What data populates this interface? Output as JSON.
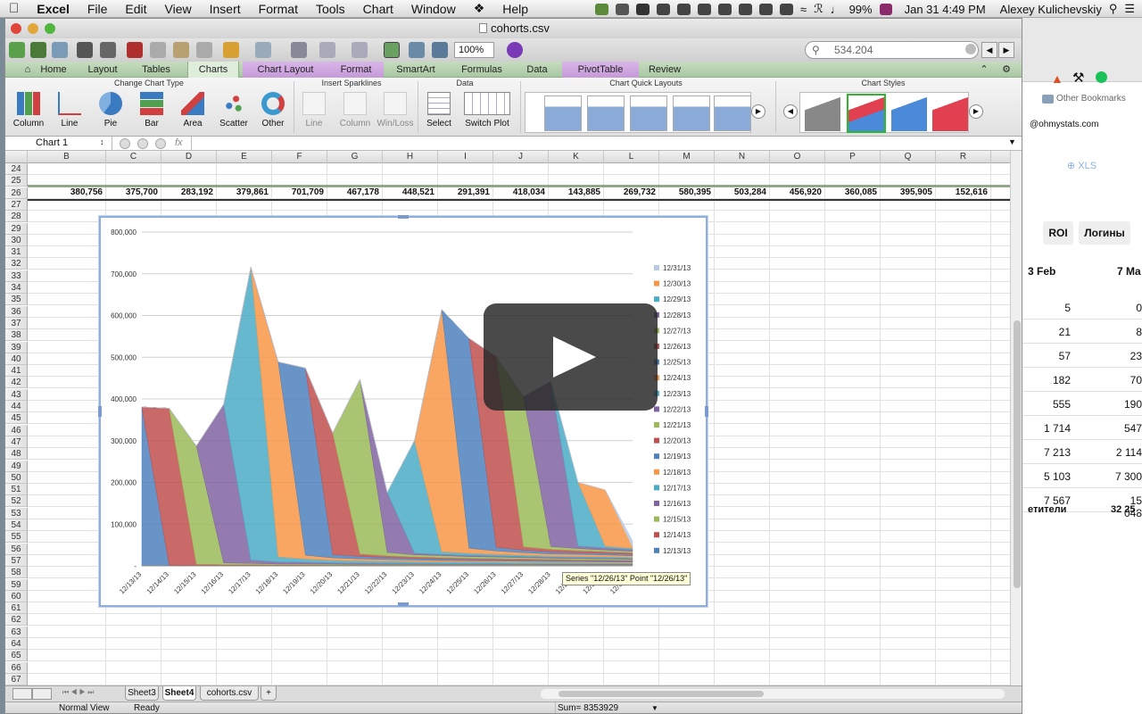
{
  "menubar": {
    "apple": "",
    "app_name": "Excel",
    "items": [
      "File",
      "Edit",
      "View",
      "Insert",
      "Format",
      "Tools",
      "Chart",
      "Window",
      "Help"
    ],
    "battery": "99%",
    "datetime": "Jan 31  4:49 PM",
    "user": "Alexey Kulichevskiy"
  },
  "window": {
    "title": "cohorts.csv"
  },
  "toolbar": {
    "zoom": "100%",
    "search_value": "534.204"
  },
  "ribbon": {
    "tabs": [
      "Home",
      "Layout",
      "Tables",
      "Charts",
      "Chart Layout",
      "Format",
      "SmartArt",
      "Formulas",
      "Data",
      "PivotTable",
      "Review"
    ],
    "groups": {
      "change_chart_type": "Change Chart Type",
      "insert_sparklines": "Insert Sparklines",
      "data": "Data",
      "chart_quick_layouts": "Chart Quick Layouts",
      "chart_styles": "Chart Styles"
    },
    "chart_types": [
      "Column",
      "Line",
      "Pie",
      "Bar",
      "Area",
      "Scatter",
      "Other"
    ],
    "sparklines": [
      "Line",
      "Column",
      "Win/Loss"
    ],
    "data_buttons": [
      "Select",
      "Switch Plot"
    ]
  },
  "formula_bar": {
    "name_box": "Chart 1",
    "fx": "fx",
    "value": ""
  },
  "grid": {
    "columns": [
      "B",
      "C",
      "D",
      "E",
      "F",
      "G",
      "H",
      "I",
      "J",
      "K",
      "L",
      "M",
      "N",
      "O",
      "P",
      "Q",
      "R"
    ],
    "rows": [
      "24",
      "25",
      "26",
      "27",
      "28",
      "29",
      "30",
      "31",
      "32",
      "33",
      "34",
      "35",
      "36",
      "37",
      "38",
      "39",
      "40",
      "41",
      "42",
      "43",
      "44",
      "45",
      "46",
      "47",
      "48",
      "49",
      "50",
      "51",
      "52",
      "53",
      "54",
      "55",
      "56",
      "57",
      "58",
      "59",
      "60",
      "61",
      "62",
      "63",
      "64",
      "65",
      "66",
      "67"
    ],
    "row25_values": [
      "380,756",
      "375,700",
      "283,192",
      "379,861",
      "701,709",
      "467,178",
      "448,521",
      "291,391",
      "418,034",
      "143,885",
      "269,732",
      "580,395",
      "503,284",
      "456,920",
      "360,085",
      "395,905",
      "152,616"
    ]
  },
  "chart_data": {
    "type": "area",
    "title": "",
    "xlabel": "",
    "ylabel": "",
    "ylim": [
      0,
      800000
    ],
    "y_ticks": [
      "800,000",
      "700,000",
      "600,000",
      "500,000",
      "400,000",
      "300,000",
      "200,000",
      "100,000",
      "-"
    ],
    "categories": [
      "12/13/13",
      "12/14/13",
      "12/15/13",
      "12/16/13",
      "12/17/13",
      "12/18/13",
      "12/19/13",
      "12/20/13",
      "12/21/13",
      "12/22/13",
      "12/23/13",
      "12/24/13",
      "12/25/13",
      "12/26/13",
      "12/27/13",
      "12/28/13",
      "12/29/13",
      "12/30/13",
      "12/31/13"
    ],
    "series": [
      {
        "name": "12/13/13",
        "color": "#4f81bd",
        "values": [
          380756,
          2000,
          1000,
          1000,
          1000,
          1000,
          1000,
          1000,
          1000,
          1000,
          1000,
          1000,
          1000,
          1000,
          1000,
          1000,
          1000,
          1000,
          1000
        ]
      },
      {
        "name": "12/14/13",
        "color": "#c0504d",
        "values": [
          0,
          375700,
          3000,
          2000,
          2000,
          1500,
          1500,
          1200,
          1200,
          1200,
          1000,
          1000,
          1000,
          1000,
          1000,
          1000,
          1000,
          1000,
          1000
        ]
      },
      {
        "name": "12/15/13",
        "color": "#9bbb59",
        "values": [
          0,
          0,
          283192,
          4000,
          3000,
          2000,
          2000,
          2000,
          1500,
          1500,
          1500,
          1200,
          1200,
          1200,
          1200,
          1000,
          1000,
          1000,
          1000
        ]
      },
      {
        "name": "12/16/13",
        "color": "#8064a2",
        "values": [
          0,
          0,
          0,
          379861,
          8000,
          5000,
          4000,
          3000,
          3000,
          2500,
          2500,
          2000,
          2000,
          2000,
          1500,
          1500,
          1500,
          1500,
          1500
        ]
      },
      {
        "name": "12/17/13",
        "color": "#4bacc6",
        "values": [
          0,
          0,
          0,
          0,
          701709,
          12000,
          8000,
          6000,
          5000,
          5000,
          4000,
          4000,
          3500,
          3500,
          3000,
          3000,
          3000,
          2500,
          2500
        ]
      },
      {
        "name": "12/18/13",
        "color": "#f79646",
        "values": [
          0,
          0,
          0,
          0,
          0,
          467178,
          9000,
          6000,
          5000,
          4000,
          4000,
          3500,
          3000,
          3000,
          3000,
          2500,
          2500,
          2500,
          2000
        ]
      },
      {
        "name": "12/19/13",
        "color": "#4f81bd",
        "values": [
          0,
          0,
          0,
          0,
          0,
          0,
          448521,
          8000,
          6000,
          5000,
          4000,
          4000,
          3500,
          3000,
          3000,
          3000,
          2500,
          2500,
          2000
        ]
      },
      {
        "name": "12/20/13",
        "color": "#c0504d",
        "values": [
          0,
          0,
          0,
          0,
          0,
          0,
          0,
          291391,
          6000,
          4000,
          3500,
          3000,
          3000,
          2500,
          2500,
          2500,
          2000,
          2000,
          2000
        ]
      },
      {
        "name": "12/21/13",
        "color": "#9bbb59",
        "values": [
          0,
          0,
          0,
          0,
          0,
          0,
          0,
          0,
          418034,
          8000,
          5000,
          5000,
          4000,
          4000,
          3500,
          3000,
          3000,
          3000,
          2500
        ]
      },
      {
        "name": "12/22/13",
        "color": "#8064a2",
        "values": [
          0,
          0,
          0,
          0,
          0,
          0,
          0,
          0,
          0,
          143885,
          4000,
          3000,
          3000,
          2500,
          2500,
          2000,
          2000,
          2000,
          2000
        ]
      },
      {
        "name": "12/23/13",
        "color": "#4bacc6",
        "values": [
          0,
          0,
          0,
          0,
          0,
          0,
          0,
          0,
          0,
          0,
          269732,
          6000,
          5000,
          4000,
          3500,
          3000,
          3000,
          3000,
          2500
        ]
      },
      {
        "name": "12/24/13",
        "color": "#f79646",
        "values": [
          0,
          0,
          0,
          0,
          0,
          0,
          0,
          0,
          0,
          0,
          0,
          580395,
          12000,
          8000,
          6000,
          5000,
          5000,
          4000,
          4000
        ]
      },
      {
        "name": "12/25/13",
        "color": "#4f81bd",
        "values": [
          0,
          0,
          0,
          0,
          0,
          0,
          0,
          0,
          0,
          0,
          0,
          0,
          503284,
          9000,
          6000,
          5000,
          4000,
          4000,
          3500
        ]
      },
      {
        "name": "12/26/13",
        "color": "#c0504d",
        "values": [
          0,
          0,
          0,
          0,
          0,
          0,
          0,
          0,
          0,
          0,
          0,
          0,
          0,
          456920,
          8000,
          6000,
          5000,
          4000,
          4000
        ]
      },
      {
        "name": "12/27/13",
        "color": "#9bbb59",
        "values": [
          0,
          0,
          0,
          0,
          0,
          0,
          0,
          0,
          0,
          0,
          0,
          0,
          0,
          0,
          360085,
          7000,
          5000,
          4000,
          3500
        ]
      },
      {
        "name": "12/28/13",
        "color": "#8064a2",
        "values": [
          0,
          0,
          0,
          0,
          0,
          0,
          0,
          0,
          0,
          0,
          0,
          0,
          0,
          0,
          0,
          395905,
          6000,
          5000,
          4000
        ]
      },
      {
        "name": "12/29/13",
        "color": "#4bacc6",
        "values": [
          0,
          0,
          0,
          0,
          0,
          0,
          0,
          0,
          0,
          0,
          0,
          0,
          0,
          0,
          0,
          0,
          152616,
          4000,
          3000
        ]
      },
      {
        "name": "12/30/13",
        "color": "#f79646",
        "values": [
          0,
          0,
          0,
          0,
          0,
          0,
          0,
          0,
          0,
          0,
          0,
          0,
          0,
          0,
          0,
          0,
          0,
          135000,
          3000
        ]
      },
      {
        "name": "12/31/13",
        "color": "#b7cbe8",
        "values": [
          0,
          0,
          0,
          0,
          0,
          0,
          0,
          0,
          0,
          0,
          0,
          0,
          0,
          0,
          0,
          0,
          0,
          0,
          15000
        ]
      }
    ],
    "grid": true,
    "legend_position": "right",
    "tooltip": "Series \"12/26/13\" Point \"12/26/13\""
  },
  "sheet_tabs": [
    "Sheet3",
    "Sheet4",
    "cohorts.csv",
    "+"
  ],
  "active_sheet": "Sheet4",
  "statusbar": {
    "view": "Normal View",
    "status": "Ready",
    "sum": "Sum= 8353929"
  },
  "background_browser": {
    "bookmarks": "Other Bookmarks",
    "email": "@ohmystats.com",
    "xls": "XLS",
    "tabs": [
      "ROI",
      "Логины"
    ],
    "col_heads": [
      "3 Feb",
      "7 Ma"
    ],
    "rows": [
      [
        "5",
        "0"
      ],
      [
        "21",
        "8"
      ],
      [
        "57",
        "23"
      ],
      [
        "182",
        "70"
      ],
      [
        "555",
        "190"
      ],
      [
        "1 714",
        "547"
      ],
      [
        "7 213",
        "2 114"
      ],
      [
        "5 103",
        "7 300"
      ],
      [
        "7 567",
        "15 048"
      ]
    ],
    "footer": [
      "етители",
      "32 25"
    ]
  },
  "colors": {
    "ribbon_green": "#a9c8a2",
    "chart_border": "#90aedc",
    "accent_purple": "#c59ad8"
  }
}
